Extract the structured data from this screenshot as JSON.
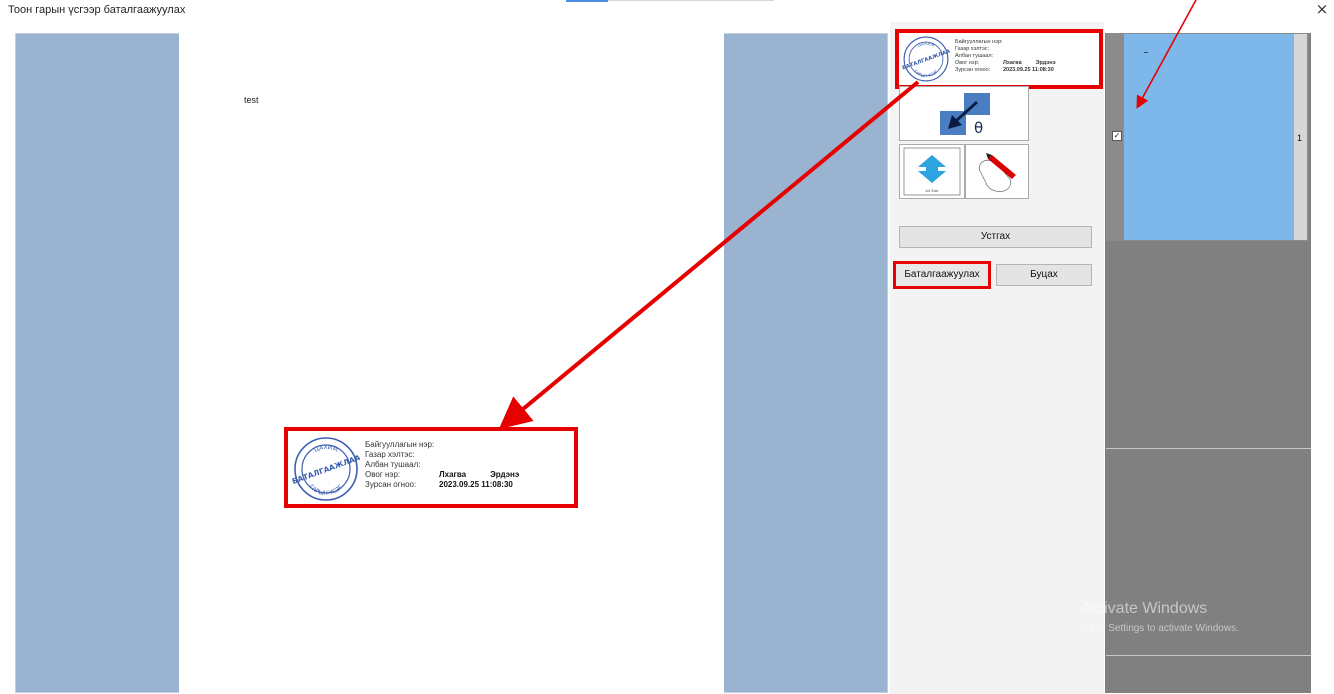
{
  "window": {
    "title": "Тоон гарын үсгээр баталгаажуулах",
    "close_glyph": "×"
  },
  "document": {
    "page_text": "test"
  },
  "signature": {
    "stamp_icon": "seal-stamp-icon",
    "stamp_text_top": "ЦАХИМ",
    "stamp_text_mid": "БАТАЛГААЖЛАА",
    "stamp_text_bottom": "ГАРЫН ҮСЭГ",
    "labels": {
      "org_name": "Байгууллагын нэр:",
      "department": "Газар хэлтэс:",
      "position": "Албан тушаал:",
      "full_name": "Овог нэр:",
      "signed_date": "Зурсан огноо:"
    },
    "last_name": "Лхагва",
    "first_name": "Эрдэнэ",
    "date": "2023.09.25 11:08:30"
  },
  "tools": {
    "place_icon": "place-signature-icon",
    "place_symbol": "θ",
    "scale_icon": "resize-arrow-icon",
    "scale_caption": "A4 Size",
    "draw_icon": "hand-pen-icon"
  },
  "buttons": {
    "delete": "Устгах",
    "confirm": "Баталгаажуулах",
    "cancel": "Буцах"
  },
  "thumbnails": {
    "items": [
      {
        "number": "1",
        "checked": "✓"
      }
    ]
  },
  "watermark": {
    "line1": "Activate Windows",
    "line2": "Go to Settings to activate Windows."
  },
  "colors": {
    "highlight": "#e60000",
    "canvas_bg": "#99b3d1",
    "thumb_selected": "#7eb7ea",
    "stamp_blue": "#3a5fb0"
  }
}
